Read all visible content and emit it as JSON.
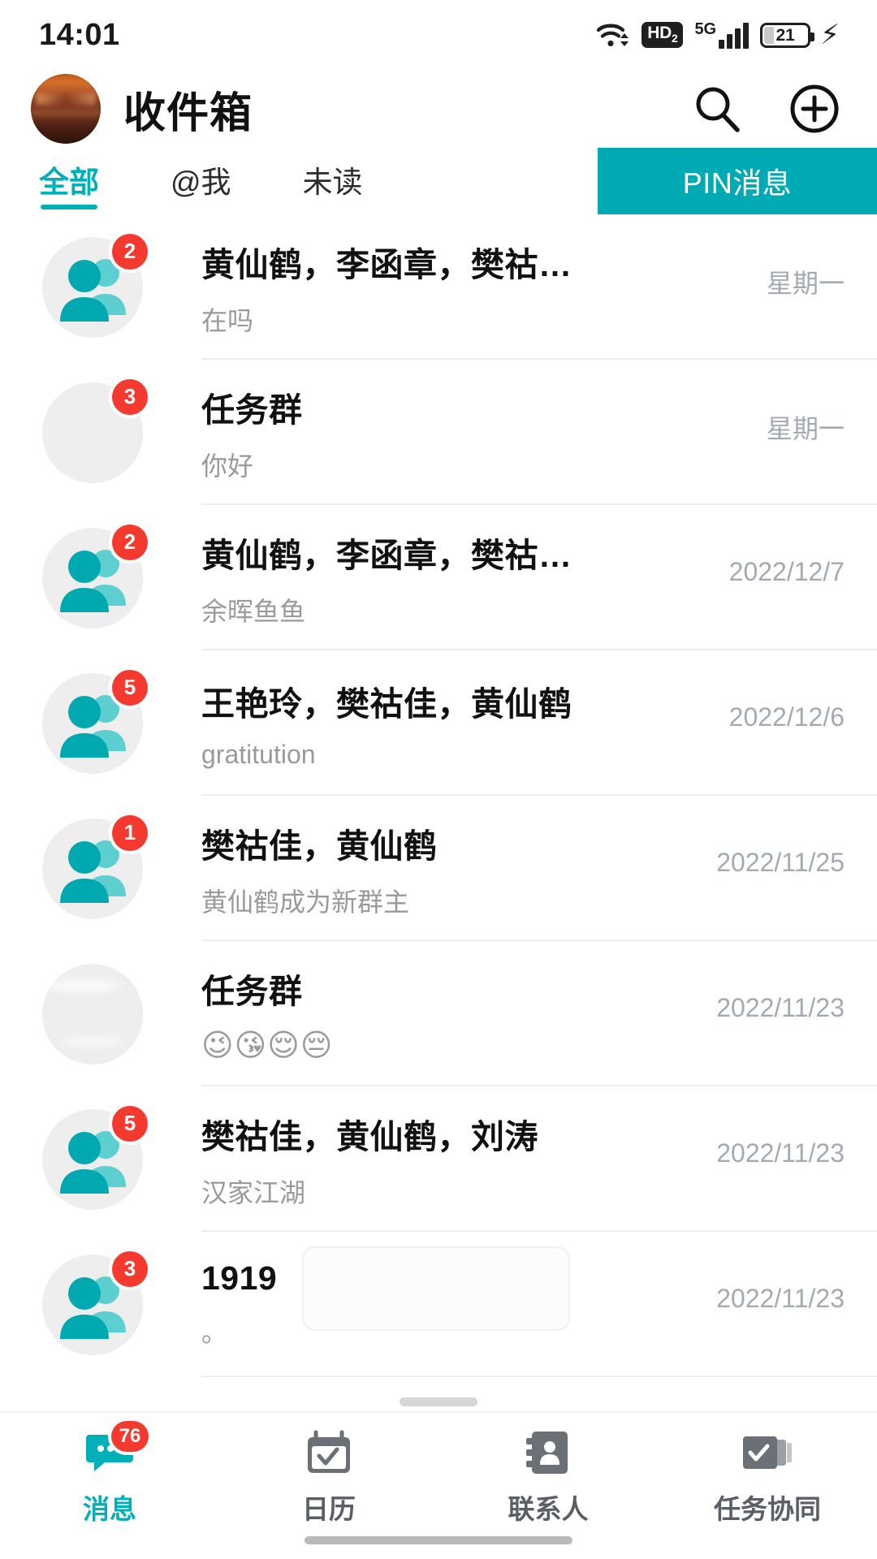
{
  "status_bar": {
    "time": "14:01",
    "wifi_icon": "wifi-icon",
    "hd_label": "HD",
    "hd_sub": "2",
    "network_label": "5G",
    "signal_icon": "signal-bars-icon",
    "battery_percent": "21",
    "charging_icon": "charging-bolt-icon"
  },
  "header": {
    "avatar_name": "user-avatar",
    "title": "收件箱",
    "search_icon": "search-icon",
    "add_icon": "plus-circle-icon"
  },
  "tabs": {
    "items": [
      {
        "label": "全部",
        "active": true
      },
      {
        "label": "@我",
        "active": false
      },
      {
        "label": "未读",
        "active": false
      }
    ],
    "pin_button": "PIN消息",
    "accent_color": "#00b0b9",
    "pin_bg_color": "#00aab4"
  },
  "conversations": [
    {
      "title": "黄仙鹤，李函章，樊祜…",
      "preview": "在吗",
      "time": "星期一",
      "badge": "2",
      "avatar_type": "group",
      "avatar_name": "group-avatar-icon"
    },
    {
      "title": "任务群",
      "preview": "你好",
      "time": "星期一",
      "badge": "3",
      "avatar_type": "photo-sunset",
      "avatar_name": "photo-avatar-sunset"
    },
    {
      "title": "黄仙鹤，李函章，樊祜…",
      "preview": "余晖鱼鱼",
      "time": "2022/12/7",
      "badge": "2",
      "avatar_type": "group",
      "avatar_name": "group-avatar-icon"
    },
    {
      "title": "王艳玲，樊祜佳，黄仙鹤",
      "preview": "gratitution",
      "time": "2022/12/6",
      "badge": "5",
      "avatar_type": "group",
      "avatar_name": "group-avatar-icon"
    },
    {
      "title": "樊祜佳，黄仙鹤",
      "preview": "黄仙鹤成为新群主",
      "time": "2022/11/25",
      "badge": "1",
      "avatar_type": "group",
      "avatar_name": "group-avatar-icon"
    },
    {
      "title": "任务群",
      "preview": "😉😘😌😔",
      "time": "2022/11/23",
      "badge": "",
      "avatar_type": "photo-sky",
      "avatar_name": "photo-avatar-sky",
      "preview_is_emoji": true
    },
    {
      "title": "樊祜佳，黄仙鹤，刘涛",
      "preview": "汉家江湖",
      "time": "2022/11/23",
      "badge": "5",
      "avatar_type": "group",
      "avatar_name": "group-avatar-icon"
    },
    {
      "title": "1919",
      "preview": "。",
      "time": "2022/11/23",
      "badge": "3",
      "avatar_type": "group",
      "avatar_name": "group-avatar-icon",
      "has_overlay_box": true
    }
  ],
  "bottom_nav": {
    "items": [
      {
        "label": "消息",
        "icon": "chat-bubble-icon",
        "badge": "76",
        "active": true
      },
      {
        "label": "日历",
        "icon": "calendar-check-icon",
        "badge": "",
        "active": false
      },
      {
        "label": "联系人",
        "icon": "contacts-book-icon",
        "badge": "",
        "active": false
      },
      {
        "label": "任务协同",
        "icon": "tasks-collab-icon",
        "badge": "",
        "active": false
      }
    ]
  }
}
